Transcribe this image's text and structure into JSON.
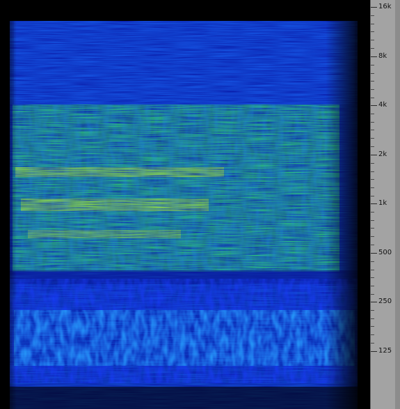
{
  "ruler": {
    "labels": [
      "16k",
      "8k",
      "4k",
      "2k",
      "1k",
      "500",
      "250",
      "125"
    ]
  },
  "colors": {
    "background": "#000000",
    "ruler_bg": "#a3a3a3",
    "low_intensity": "#0a1aa8",
    "mid_intensity": "#1e8cff",
    "high_intensity": "#3cff3c",
    "peak_intensity": "#ffff00"
  }
}
